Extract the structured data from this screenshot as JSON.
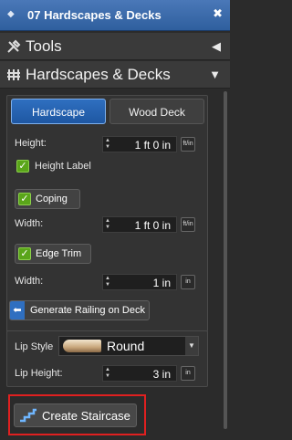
{
  "window": {
    "title": "07 Hardscapes & Decks"
  },
  "tools_section": {
    "label": "Tools"
  },
  "hardscapes_section": {
    "label": "Hardscapes & Decks"
  },
  "tabs": [
    {
      "label": "Hardscape",
      "active": true
    },
    {
      "label": "Wood Deck",
      "active": false
    }
  ],
  "hardscape": {
    "height_label": "Height:",
    "height_value": "1 ft 0 in",
    "height_unit_btn": "ft/in",
    "height_label_check": "Height Label"
  },
  "coping": {
    "label": "Coping",
    "width_label": "Width:",
    "width_value": "1 ft 0 in",
    "width_unit_btn": "ft/in"
  },
  "edge_trim": {
    "label": "Edge Trim",
    "width_label": "Width:",
    "width_value": "1 in",
    "width_unit_btn": "in"
  },
  "railing": {
    "label": "Generate Railing on Deck"
  },
  "lip": {
    "style_label": "Lip Style",
    "style_value": "Round",
    "height_label": "Lip Height:",
    "height_value": "3 in",
    "height_unit_btn": "in"
  },
  "staircase": {
    "label": "Create Staircase"
  },
  "colors": {
    "accent": "#2f6fc0",
    "highlight_box": "#e02020",
    "check": "#5aa51a"
  }
}
